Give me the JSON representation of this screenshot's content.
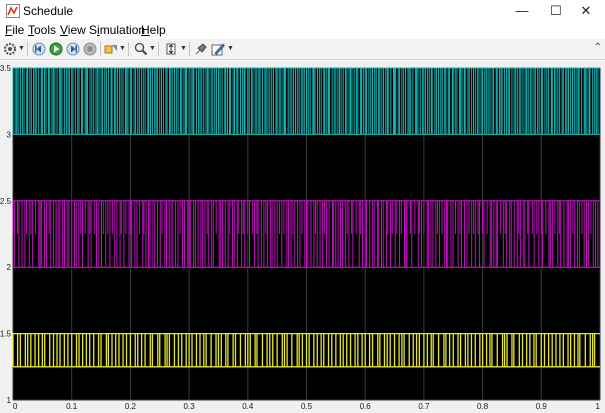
{
  "window": {
    "title": "Schedule",
    "controls": {
      "minimize": "—",
      "maximize": "☐",
      "close": "✕"
    }
  },
  "menu": [
    {
      "pre": "",
      "key": "F",
      "post": "ile"
    },
    {
      "pre": "",
      "key": "T",
      "post": "ools"
    },
    {
      "pre": "",
      "key": "V",
      "post": "iew"
    },
    {
      "pre": "S",
      "key": "i",
      "post": "mulation"
    },
    {
      "pre": "",
      "key": "H",
      "post": "elp"
    }
  ],
  "toolbar": {
    "icons": [
      "settings-gear-icon",
      "step-back-icon",
      "run-icon",
      "step-forward-icon",
      "stop-icon",
      "highlight-icon",
      "zoom-icon",
      "autoscale-icon",
      "cursor-measure-icon",
      "edit-icon"
    ]
  },
  "colors": {
    "plot_bg": "#000000",
    "grid": "#3a3a3a",
    "signal1": "#19b3b3",
    "signal2": "#c010c0",
    "signal3": "#e6e62a"
  },
  "chart_data": {
    "type": "line",
    "x_range": [
      0,
      1
    ],
    "y_range": [
      1,
      3.5
    ],
    "x_ticks": [
      "0",
      "0.1",
      "0.2",
      "0.3",
      "0.4",
      "0.5",
      "0.6",
      "0.7",
      "0.8",
      "0.9",
      "1"
    ],
    "y_ticks": [
      "1",
      "1.5",
      "2",
      "2.5",
      "3",
      "3.5"
    ],
    "grid": true,
    "series": [
      {
        "color": "#19b3b3",
        "low": 3,
        "high": 3.5,
        "pulses": 160
      },
      {
        "color": "#c010c0",
        "low": 2,
        "high": 2.5,
        "mid": 2.25,
        "pulses": 130
      },
      {
        "color": "#e6e62a",
        "low": 1.25,
        "high": 1.5,
        "pulses": 80
      }
    ]
  }
}
